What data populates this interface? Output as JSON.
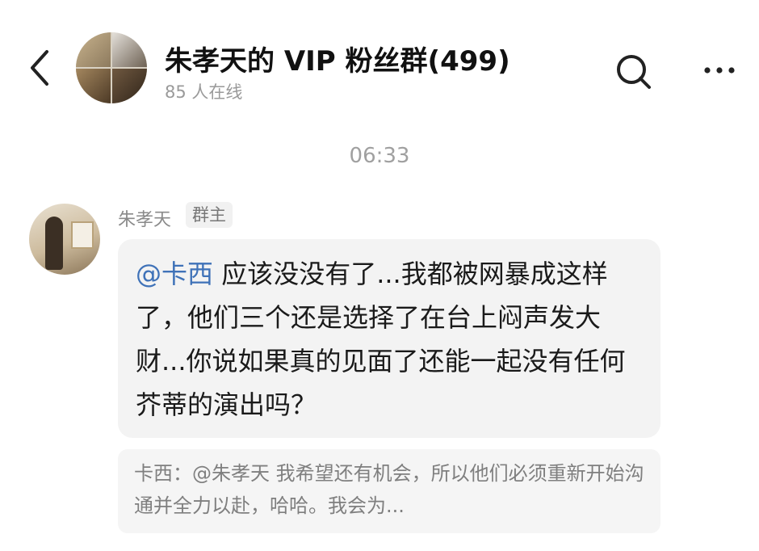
{
  "header": {
    "back_icon": "chevron-left-icon",
    "group_title": "朱孝天的 VIP 粉丝群(499)",
    "online_count": "85 人在线",
    "search_icon": "search-icon",
    "more_icon": "more-icon"
  },
  "chat": {
    "time": "06:33",
    "message": {
      "sender": "朱孝天",
      "role": "群主",
      "mention": "@卡西",
      "text": " 应该没没有了...我都被网暴成这样了，他们三个还是选择了在台上闷声发大财...你说如果真的见面了还能一起没有任何芥蒂的演出吗？"
    },
    "quote": {
      "text": "卡西：@朱孝天 我希望还有机会，所以他们必须重新开始沟通并全力以赴，哈哈。我会为..."
    }
  }
}
